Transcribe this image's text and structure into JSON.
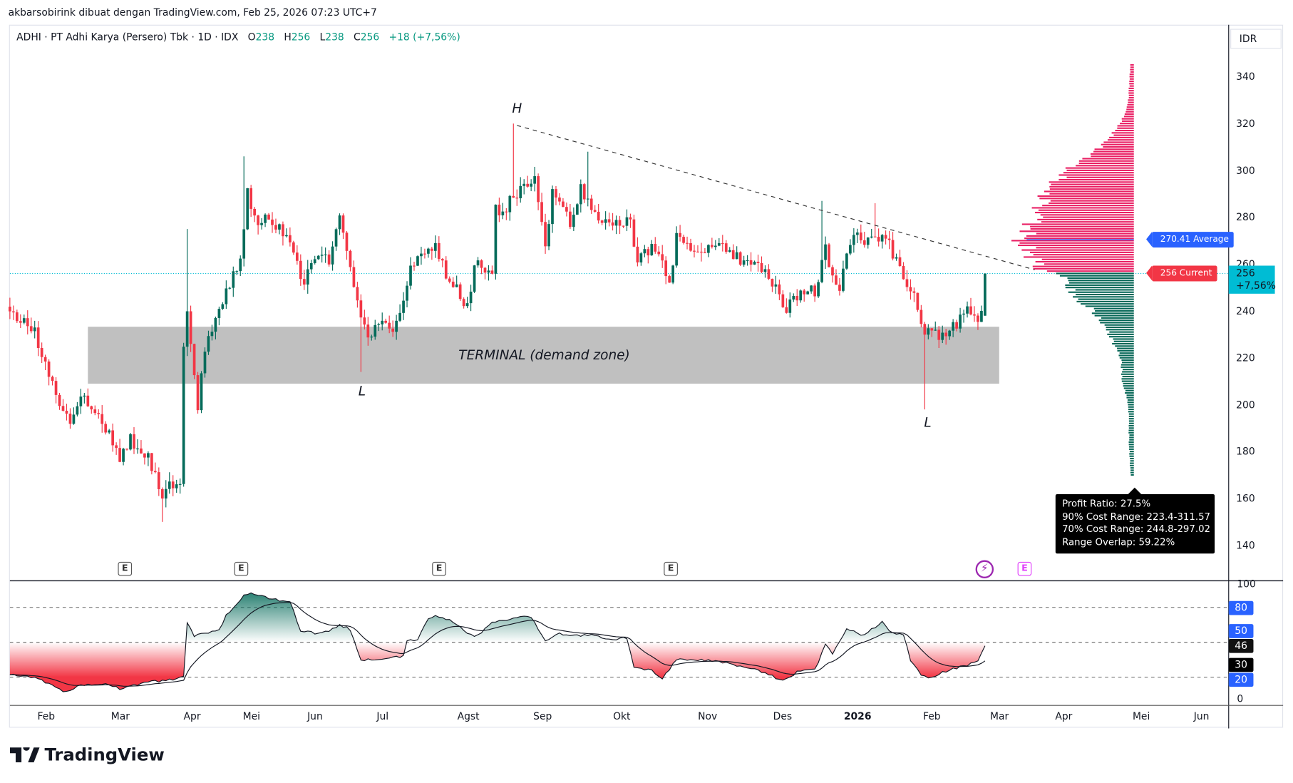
{
  "header": {
    "attribution": "akbarsobirink dibuat dengan TradingView.com, Feb 25, 2026 07:23 UTC+7"
  },
  "legend": {
    "symbol": "ADHI · PT Adhi Karya (Persero) Tbk · 1D · IDX",
    "o_label": "O",
    "o": "238",
    "h_label": "H",
    "h": "256",
    "l_label": "L",
    "l": "238",
    "c_label": "C",
    "c": "256",
    "change": "+18 (+7,56%)"
  },
  "currency": "IDR",
  "current_price": {
    "value": "256",
    "change": "+7,56%"
  },
  "labels": {
    "average": "270.41 Average",
    "current": "256 Current"
  },
  "tooltip": {
    "lines": [
      "Profit Ratio: 27.5%",
      "90% Cost Range: 223.4-311.57",
      "70% Cost Range: 244.8-297.02",
      "Range Overlap: 59.22%"
    ]
  },
  "annotations": {
    "zone_label": "TERMINAL (demand zone)",
    "high": "H",
    "low_1": "L",
    "low_2": "L"
  },
  "events": {
    "earnings": "E"
  },
  "oscillator": {
    "top": "100",
    "bottom": "0",
    "badges": {
      "b80": "80",
      "b50": "50",
      "b46": "46",
      "b30": "30",
      "b20": "20"
    }
  },
  "time_axis": [
    "Feb",
    "Mar",
    "Apr",
    "Mei",
    "Jun",
    "Jul",
    "Agst",
    "Sep",
    "Okt",
    "Nov",
    "Des",
    "2026",
    "Feb",
    "Mar",
    "Apr",
    "Mei",
    "Jun"
  ],
  "brand": "TradingView",
  "colors": {
    "up": "#056b5a",
    "down": "#f23645",
    "profile_up": "#e91e63",
    "profile_down": "#056656",
    "average": "#2962ff",
    "current": "#00bcd4",
    "zone": "#c0c0c0"
  },
  "chart_data": {
    "type": "candlestick",
    "title": "ADHI · PT Adhi Karya (Persero) Tbk · 1D · IDX",
    "y_ticks": [
      340,
      320,
      300,
      280,
      260,
      240,
      220,
      200,
      180,
      160,
      140
    ],
    "ylim": [
      120,
      360
    ],
    "bar_count": 276,
    "close_waypoints": [
      [
        0,
        238
      ],
      [
        7,
        232
      ],
      [
        11,
        211
      ],
      [
        17,
        193
      ],
      [
        20,
        205
      ],
      [
        25,
        197
      ],
      [
        31,
        176
      ],
      [
        34,
        186
      ],
      [
        39,
        177
      ],
      [
        43,
        162
      ],
      [
        46,
        167
      ],
      [
        48,
        169
      ],
      [
        49,
        225
      ],
      [
        50,
        239
      ],
      [
        53,
        200
      ],
      [
        55,
        225
      ],
      [
        58,
        235
      ],
      [
        61,
        249
      ],
      [
        65,
        263
      ],
      [
        67,
        290
      ],
      [
        69,
        278
      ],
      [
        74,
        279
      ],
      [
        79,
        267
      ],
      [
        83,
        253
      ],
      [
        87,
        264
      ],
      [
        90,
        260
      ],
      [
        93,
        279
      ],
      [
        96,
        260
      ],
      [
        99,
        235
      ],
      [
        101,
        228
      ],
      [
        104,
        235
      ],
      [
        108,
        230
      ],
      [
        111,
        246
      ],
      [
        113,
        260
      ],
      [
        117,
        264
      ],
      [
        120,
        267
      ],
      [
        124,
        253
      ],
      [
        129,
        242
      ],
      [
        132,
        264
      ],
      [
        136,
        253
      ],
      [
        137,
        283
      ],
      [
        140,
        285
      ],
      [
        143,
        290
      ],
      [
        146,
        292
      ],
      [
        148,
        297
      ],
      [
        151,
        267
      ],
      [
        153,
        293
      ],
      [
        158,
        278
      ],
      [
        161,
        292
      ],
      [
        163,
        288
      ],
      [
        166,
        281
      ],
      [
        170,
        279
      ],
      [
        175,
        278
      ],
      [
        177,
        262
      ],
      [
        181,
        267
      ],
      [
        186,
        253
      ],
      [
        188,
        271
      ],
      [
        193,
        267
      ],
      [
        197,
        267
      ],
      [
        202,
        267
      ],
      [
        207,
        260
      ],
      [
        211,
        258
      ],
      [
        215,
        253
      ],
      [
        219,
        241
      ],
      [
        223,
        249
      ],
      [
        227,
        248
      ],
      [
        230,
        267
      ],
      [
        232,
        256
      ],
      [
        234,
        251
      ],
      [
        237,
        271
      ],
      [
        240,
        271
      ],
      [
        244,
        269
      ],
      [
        247,
        271
      ],
      [
        250,
        260
      ],
      [
        253,
        251
      ],
      [
        255,
        248
      ],
      [
        258,
        228
      ],
      [
        260,
        234
      ],
      [
        263,
        228
      ],
      [
        267,
        235
      ],
      [
        270,
        239
      ],
      [
        274,
        238
      ],
      [
        275,
        256
      ]
    ],
    "wick_extremes": [
      {
        "i": 43,
        "low": 150
      },
      {
        "i": 50,
        "high": 275
      },
      {
        "i": 66,
        "high": 306
      },
      {
        "i": 99,
        "low": 214
      },
      {
        "i": 142,
        "high": 320
      },
      {
        "i": 163,
        "high": 308
      },
      {
        "i": 229,
        "high": 287
      },
      {
        "i": 244,
        "high": 286
      },
      {
        "i": 258,
        "low": 198
      }
    ],
    "last_bar": {
      "open": 238,
      "high": 256,
      "low": 238,
      "close": 256
    },
    "current_price": 256,
    "demand_zone": {
      "price_range": [
        209,
        233.3
      ],
      "bar_range": [
        22,
        279
      ]
    },
    "trendline": {
      "from": [
        143,
        319.2
      ],
      "to": [
        289,
        257.6
      ]
    },
    "volume_profile": {
      "price_range": [
        170,
        345
      ],
      "average": 270.41,
      "relative_volume": [
        [
          170,
          0.03
        ],
        [
          180,
          0.04
        ],
        [
          200,
          0.05
        ],
        [
          210,
          0.1
        ],
        [
          220,
          0.12
        ],
        [
          228,
          0.2
        ],
        [
          235,
          0.3
        ],
        [
          240,
          0.36
        ],
        [
          245,
          0.5
        ],
        [
          250,
          0.56
        ],
        [
          254,
          0.62
        ],
        [
          256,
          0.72
        ],
        [
          258,
          0.85
        ],
        [
          265,
          0.93
        ],
        [
          270,
          1
        ],
        [
          275,
          0.95
        ],
        [
          280,
          0.86
        ],
        [
          290,
          0.8
        ],
        [
          295,
          0.7
        ],
        [
          300,
          0.6
        ],
        [
          305,
          0.45
        ],
        [
          310,
          0.3
        ],
        [
          315,
          0.2
        ],
        [
          320,
          0.12
        ],
        [
          325,
          0.08
        ],
        [
          330,
          0.05
        ],
        [
          345,
          0.03
        ]
      ]
    },
    "oscillator": {
      "levels": [
        80,
        50,
        20
      ],
      "ylim": [
        0,
        100
      ],
      "signal_ema": 14,
      "main_waypoints": [
        [
          0,
          22
        ],
        [
          7,
          20
        ],
        [
          16,
          7
        ],
        [
          20,
          13
        ],
        [
          27,
          15
        ],
        [
          31,
          10
        ],
        [
          39,
          16
        ],
        [
          44,
          17
        ],
        [
          49,
          20
        ],
        [
          50,
          67
        ],
        [
          52,
          55
        ],
        [
          55,
          58
        ],
        [
          59,
          61
        ],
        [
          61,
          73
        ],
        [
          63,
          79
        ],
        [
          66,
          91
        ],
        [
          68,
          92
        ],
        [
          74,
          87
        ],
        [
          79,
          85
        ],
        [
          82,
          60
        ],
        [
          86,
          58
        ],
        [
          90,
          60
        ],
        [
          93,
          65
        ],
        [
          96,
          61
        ],
        [
          99,
          35
        ],
        [
          101,
          35
        ],
        [
          107,
          37
        ],
        [
          111,
          38
        ],
        [
          112,
          52
        ],
        [
          115,
          52
        ],
        [
          118,
          71
        ],
        [
          120,
          73
        ],
        [
          125,
          68
        ],
        [
          130,
          56
        ],
        [
          132,
          56
        ],
        [
          136,
          68
        ],
        [
          139,
          68
        ],
        [
          144,
          73
        ],
        [
          147,
          71
        ],
        [
          151,
          52
        ],
        [
          155,
          57
        ],
        [
          160,
          56
        ],
        [
          165,
          56
        ],
        [
          169,
          52
        ],
        [
          174,
          54
        ],
        [
          176,
          28
        ],
        [
          181,
          26
        ],
        [
          184,
          19
        ],
        [
          188,
          35
        ],
        [
          193,
          34
        ],
        [
          197,
          35
        ],
        [
          202,
          32
        ],
        [
          207,
          28
        ],
        [
          211,
          26
        ],
        [
          218,
          17
        ],
        [
          223,
          26
        ],
        [
          227,
          26
        ],
        [
          230,
          48
        ],
        [
          232,
          40
        ],
        [
          236,
          61
        ],
        [
          239,
          58
        ],
        [
          241,
          56
        ],
        [
          246,
          68
        ],
        [
          248,
          60
        ],
        [
          252,
          56
        ],
        [
          254,
          35
        ],
        [
          257,
          22
        ],
        [
          259,
          19
        ],
        [
          263,
          24
        ],
        [
          267,
          28
        ],
        [
          273,
          33
        ],
        [
          275,
          47
        ]
      ]
    }
  }
}
